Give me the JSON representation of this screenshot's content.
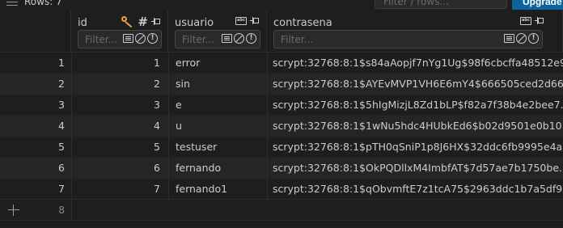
{
  "toolbar": {
    "rows_label": "Rows: 7",
    "filter_placeholder": "Filter / rows...",
    "upgrade_label": "Upgrade"
  },
  "columns": [
    {
      "name": "id",
      "filter_placeholder": "Filter...",
      "icons": [
        "key-icon",
        "hash-icon",
        "pin-icon"
      ]
    },
    {
      "name": "usuario",
      "filter_placeholder": "Filter...",
      "icons": [
        "text-type-icon",
        "pin-icon"
      ]
    },
    {
      "name": "contrasena",
      "filter_placeholder": "Filter...",
      "icons": [
        "text-type-icon",
        "pin-icon"
      ]
    }
  ],
  "rows": [
    {
      "num": "1",
      "id": "1",
      "usuario": "error",
      "contrasena": "scrypt:32768:8:1$s84aAopjf7nYg1Ug$98f6cbcffa48512e9..."
    },
    {
      "num": "2",
      "id": "2",
      "usuario": "sin",
      "contrasena": "scrypt:32768:8:1$AYEvMVP1VH6E6mY4$666505ced2d66..."
    },
    {
      "num": "3",
      "id": "3",
      "usuario": "e",
      "contrasena": "scrypt:32768:8:1$5hIgMizjL8Zd1bLP$f82a7f38b4e2bee7..."
    },
    {
      "num": "4",
      "id": "4",
      "usuario": "u",
      "contrasena": "scrypt:32768:8:1$1wNu5hdc4HUbkEd6$b02d9501e0b10..."
    },
    {
      "num": "5",
      "id": "5",
      "usuario": "testuser",
      "contrasena": "scrypt:32768:8:1$pTH0qSniP1p8J6HX$32ddc6fb9995e4a..."
    },
    {
      "num": "6",
      "id": "6",
      "usuario": "fernando",
      "contrasena": "scrypt:32768:8:1$OkPQDllxM4ImbfAT$7d57ae7b1750be..."
    },
    {
      "num": "7",
      "id": "7",
      "usuario": "fernando1",
      "contrasena": "scrypt:32768:8:1$qObvmftE7z1tcA75$2963ddc1b7a5df9..."
    }
  ],
  "new_row": {
    "num": "8"
  },
  "colors": {
    "background": "#1e1e1e",
    "row_alt": "#252526",
    "accent": "#0e639c",
    "key_icon": "#e8a33d"
  }
}
